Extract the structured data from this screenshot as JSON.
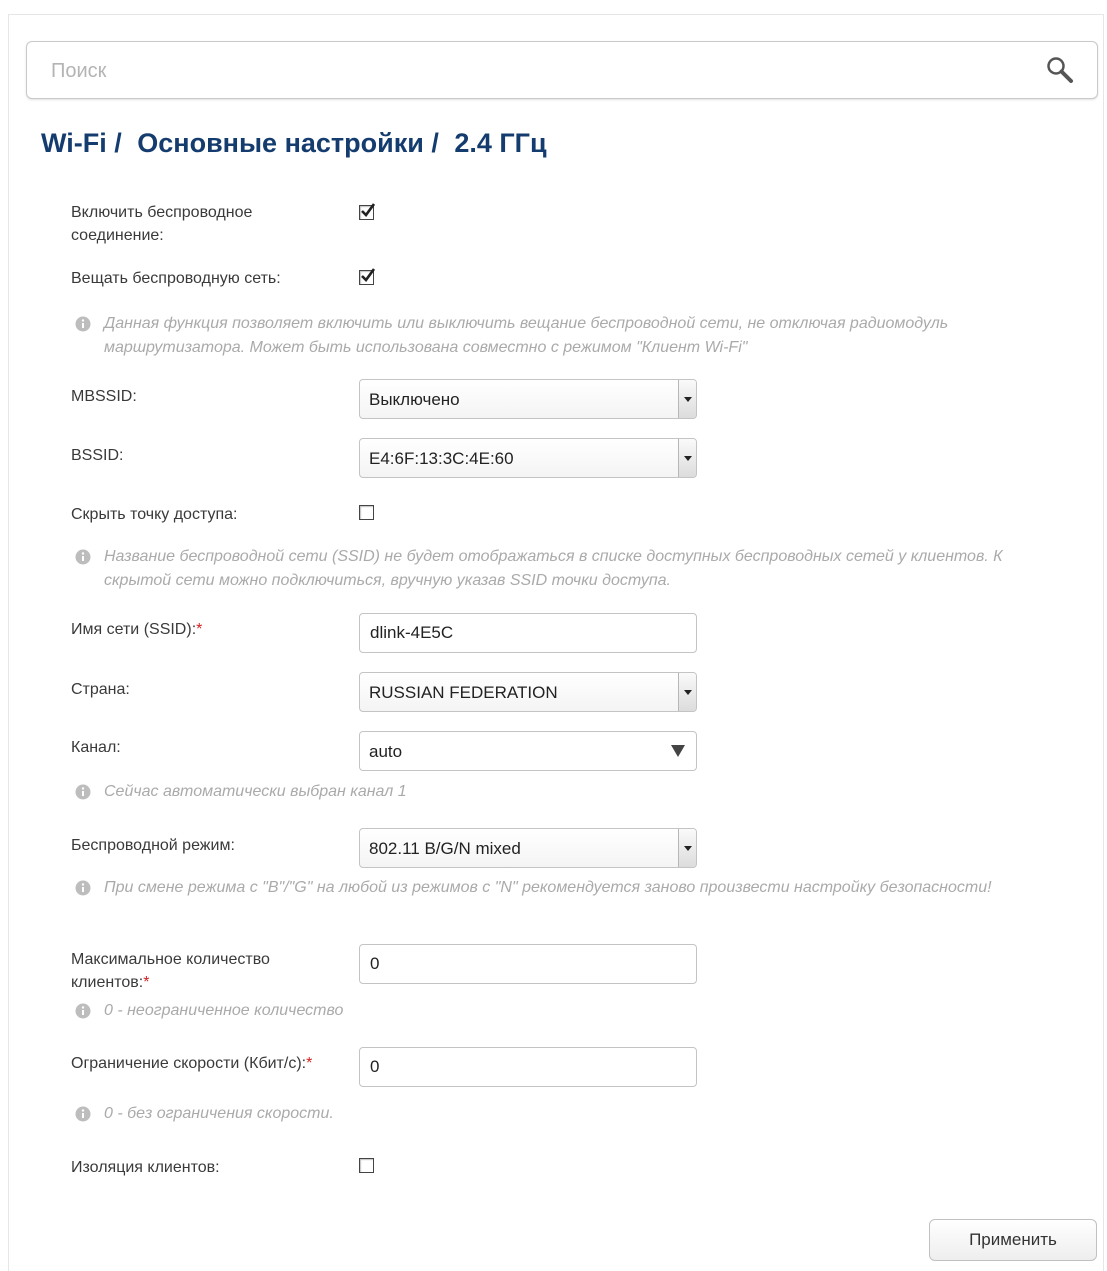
{
  "search": {
    "placeholder": "Поиск"
  },
  "breadcrumb": [
    "Wi-Fi /",
    "Основные настройки /",
    "2.4 ГГц"
  ],
  "fields": {
    "enable_wireless": {
      "label": "Включить беспроводное соединение:",
      "checked": true
    },
    "broadcast": {
      "label": "Вещать беспроводную сеть:",
      "checked": true
    },
    "broadcast_hint": "Данная функция позволяет включить или выключить вещание беспроводной сети, не отключая радиомодуль маршрутизатора. Может быть использована совместно с режимом \"Клиент Wi-Fi\"",
    "mbssid": {
      "label": "MBSSID:",
      "value": "Выключено"
    },
    "bssid": {
      "label": "BSSID:",
      "value": "E4:6F:13:3C:4E:60"
    },
    "hide_ap": {
      "label": "Скрыть точку доступа:",
      "checked": false
    },
    "hide_ap_hint": "Название беспроводной сети (SSID) не будет отображаться в списке доступных беспроводных сетей у клиентов. К скрытой сети можно подключиться, вручную указав SSID точки доступа.",
    "ssid": {
      "label": "Имя сети (SSID):",
      "required": "*",
      "value": "dlink-4E5C"
    },
    "country": {
      "label": "Страна:",
      "value": "RUSSIAN FEDERATION"
    },
    "channel": {
      "label": "Канал:",
      "value": "auto"
    },
    "channel_hint": "Сейчас автоматически выбран канал 1",
    "wireless_mode": {
      "label": "Беспроводной режим:",
      "value": "802.11 B/G/N mixed"
    },
    "wireless_mode_hint": "При смене режима с \"B\"/\"G\" на любой из режимов с \"N\" рекомендуется заново произвести настройку безопасности!",
    "max_clients": {
      "label": "Максимальное количество клиентов:",
      "required": "*",
      "value": "0"
    },
    "max_clients_hint": "0 - неограниченное количество",
    "speed_limit": {
      "label": "Ограничение скорости (Кбит/с):",
      "required": "*",
      "value": "0"
    },
    "speed_limit_hint": "0 - без ограничения скорости.",
    "client_isolation": {
      "label": "Изоляция клиентов:",
      "checked": false
    }
  },
  "apply_label": "Применить"
}
